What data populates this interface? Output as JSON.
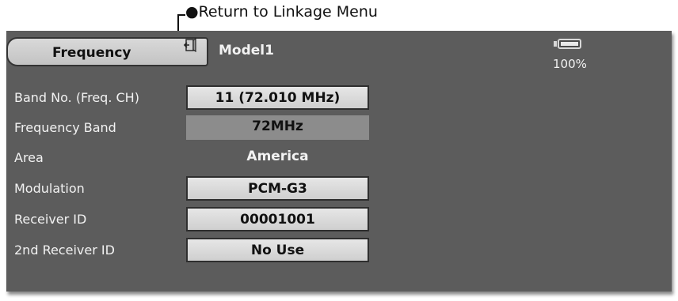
{
  "annotation": {
    "return_label": "●Return to Linkage Menu"
  },
  "header": {
    "title": "Frequency",
    "model_name": "Model1",
    "battery_percent_label": "100%",
    "battery_level": 1.0,
    "icons": {
      "return": "return-door-icon",
      "battery": "battery-icon"
    }
  },
  "rows": [
    {
      "label": "Band No. (Freq. CH)",
      "value": "11 (72.010 MHz)"
    },
    {
      "label": "Frequency Band",
      "value": "72MHz"
    },
    {
      "label": "Area",
      "value": "America"
    },
    {
      "label": "Modulation",
      "value": "PCM-G3"
    },
    {
      "label": "Receiver ID",
      "value": "00001001"
    },
    {
      "label": "2nd Receiver ID",
      "value": "No Use"
    }
  ],
  "colors": {
    "screen_background": "#5c5c5c",
    "button_face": "#d9d9d9",
    "disabled_field": "#8c8c8c",
    "text_light": "#f2f2f2"
  }
}
